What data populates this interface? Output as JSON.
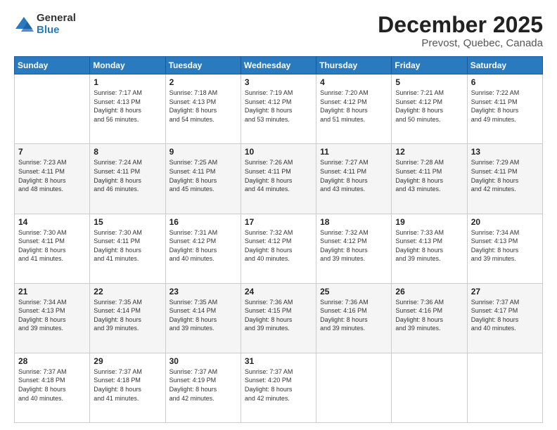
{
  "logo": {
    "general": "General",
    "blue": "Blue"
  },
  "header": {
    "month": "December 2025",
    "location": "Prevost, Quebec, Canada"
  },
  "weekdays": [
    "Sunday",
    "Monday",
    "Tuesday",
    "Wednesday",
    "Thursday",
    "Friday",
    "Saturday"
  ],
  "weeks": [
    [
      {
        "day": "",
        "info": ""
      },
      {
        "day": "1",
        "info": "Sunrise: 7:17 AM\nSunset: 4:13 PM\nDaylight: 8 hours\nand 56 minutes."
      },
      {
        "day": "2",
        "info": "Sunrise: 7:18 AM\nSunset: 4:13 PM\nDaylight: 8 hours\nand 54 minutes."
      },
      {
        "day": "3",
        "info": "Sunrise: 7:19 AM\nSunset: 4:12 PM\nDaylight: 8 hours\nand 53 minutes."
      },
      {
        "day": "4",
        "info": "Sunrise: 7:20 AM\nSunset: 4:12 PM\nDaylight: 8 hours\nand 51 minutes."
      },
      {
        "day": "5",
        "info": "Sunrise: 7:21 AM\nSunset: 4:12 PM\nDaylight: 8 hours\nand 50 minutes."
      },
      {
        "day": "6",
        "info": "Sunrise: 7:22 AM\nSunset: 4:11 PM\nDaylight: 8 hours\nand 49 minutes."
      }
    ],
    [
      {
        "day": "7",
        "info": "Sunrise: 7:23 AM\nSunset: 4:11 PM\nDaylight: 8 hours\nand 48 minutes."
      },
      {
        "day": "8",
        "info": "Sunrise: 7:24 AM\nSunset: 4:11 PM\nDaylight: 8 hours\nand 46 minutes."
      },
      {
        "day": "9",
        "info": "Sunrise: 7:25 AM\nSunset: 4:11 PM\nDaylight: 8 hours\nand 45 minutes."
      },
      {
        "day": "10",
        "info": "Sunrise: 7:26 AM\nSunset: 4:11 PM\nDaylight: 8 hours\nand 44 minutes."
      },
      {
        "day": "11",
        "info": "Sunrise: 7:27 AM\nSunset: 4:11 PM\nDaylight: 8 hours\nand 43 minutes."
      },
      {
        "day": "12",
        "info": "Sunrise: 7:28 AM\nSunset: 4:11 PM\nDaylight: 8 hours\nand 43 minutes."
      },
      {
        "day": "13",
        "info": "Sunrise: 7:29 AM\nSunset: 4:11 PM\nDaylight: 8 hours\nand 42 minutes."
      }
    ],
    [
      {
        "day": "14",
        "info": "Sunrise: 7:30 AM\nSunset: 4:11 PM\nDaylight: 8 hours\nand 41 minutes."
      },
      {
        "day": "15",
        "info": "Sunrise: 7:30 AM\nSunset: 4:11 PM\nDaylight: 8 hours\nand 41 minutes."
      },
      {
        "day": "16",
        "info": "Sunrise: 7:31 AM\nSunset: 4:12 PM\nDaylight: 8 hours\nand 40 minutes."
      },
      {
        "day": "17",
        "info": "Sunrise: 7:32 AM\nSunset: 4:12 PM\nDaylight: 8 hours\nand 40 minutes."
      },
      {
        "day": "18",
        "info": "Sunrise: 7:32 AM\nSunset: 4:12 PM\nDaylight: 8 hours\nand 39 minutes."
      },
      {
        "day": "19",
        "info": "Sunrise: 7:33 AM\nSunset: 4:13 PM\nDaylight: 8 hours\nand 39 minutes."
      },
      {
        "day": "20",
        "info": "Sunrise: 7:34 AM\nSunset: 4:13 PM\nDaylight: 8 hours\nand 39 minutes."
      }
    ],
    [
      {
        "day": "21",
        "info": "Sunrise: 7:34 AM\nSunset: 4:13 PM\nDaylight: 8 hours\nand 39 minutes."
      },
      {
        "day": "22",
        "info": "Sunrise: 7:35 AM\nSunset: 4:14 PM\nDaylight: 8 hours\nand 39 minutes."
      },
      {
        "day": "23",
        "info": "Sunrise: 7:35 AM\nSunset: 4:14 PM\nDaylight: 8 hours\nand 39 minutes."
      },
      {
        "day": "24",
        "info": "Sunrise: 7:36 AM\nSunset: 4:15 PM\nDaylight: 8 hours\nand 39 minutes."
      },
      {
        "day": "25",
        "info": "Sunrise: 7:36 AM\nSunset: 4:16 PM\nDaylight: 8 hours\nand 39 minutes."
      },
      {
        "day": "26",
        "info": "Sunrise: 7:36 AM\nSunset: 4:16 PM\nDaylight: 8 hours\nand 39 minutes."
      },
      {
        "day": "27",
        "info": "Sunrise: 7:37 AM\nSunset: 4:17 PM\nDaylight: 8 hours\nand 40 minutes."
      }
    ],
    [
      {
        "day": "28",
        "info": "Sunrise: 7:37 AM\nSunset: 4:18 PM\nDaylight: 8 hours\nand 40 minutes."
      },
      {
        "day": "29",
        "info": "Sunrise: 7:37 AM\nSunset: 4:18 PM\nDaylight: 8 hours\nand 41 minutes."
      },
      {
        "day": "30",
        "info": "Sunrise: 7:37 AM\nSunset: 4:19 PM\nDaylight: 8 hours\nand 42 minutes."
      },
      {
        "day": "31",
        "info": "Sunrise: 7:37 AM\nSunset: 4:20 PM\nDaylight: 8 hours\nand 42 minutes."
      },
      {
        "day": "",
        "info": ""
      },
      {
        "day": "",
        "info": ""
      },
      {
        "day": "",
        "info": ""
      }
    ]
  ]
}
